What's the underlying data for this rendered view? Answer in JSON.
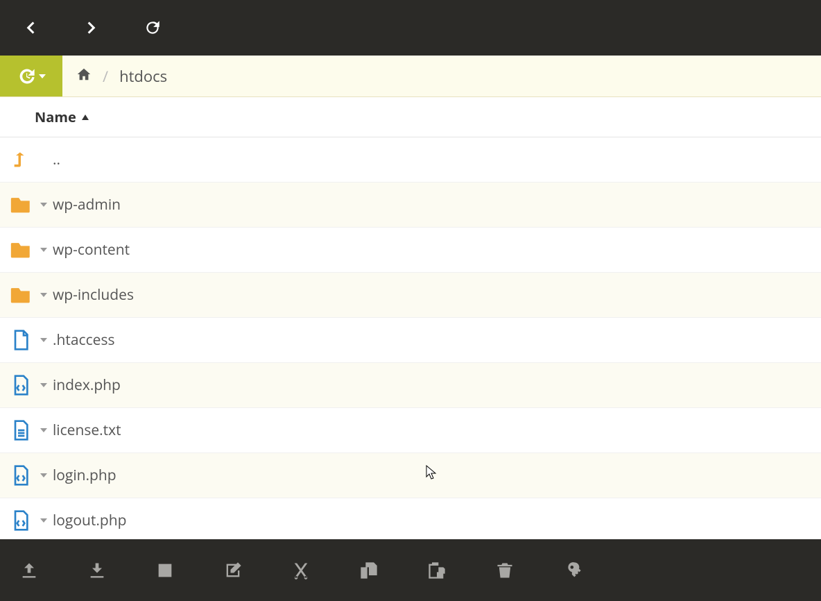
{
  "breadcrumb": {
    "segments": [
      "htdocs"
    ],
    "separator": "/"
  },
  "columns": {
    "name": "Name"
  },
  "entries": [
    {
      "name": "..",
      "type": "up",
      "caret": false
    },
    {
      "name": "wp-admin",
      "type": "folder",
      "caret": true
    },
    {
      "name": "wp-content",
      "type": "folder",
      "caret": true
    },
    {
      "name": "wp-includes",
      "type": "folder",
      "caret": true
    },
    {
      "name": ".htaccess",
      "type": "file",
      "caret": true
    },
    {
      "name": "index.php",
      "type": "code",
      "caret": true
    },
    {
      "name": "license.txt",
      "type": "text",
      "caret": true
    },
    {
      "name": "login.php",
      "type": "code",
      "caret": true
    },
    {
      "name": "logout.php",
      "type": "code",
      "caret": true
    }
  ],
  "colors": {
    "folder": "#f1a736",
    "file": "#2b82c9",
    "accent": "#b6c12e",
    "topbar": "#2b2a27"
  }
}
